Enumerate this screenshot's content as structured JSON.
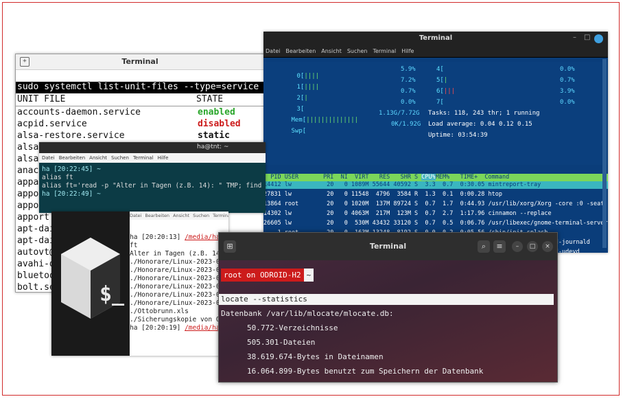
{
  "winA": {
    "title": "Terminal",
    "command": "sudo systemctl list-unit-files --type=service",
    "col_unit": "UNIT FILE",
    "col_state": "STATE",
    "rows": [
      {
        "unit": "accounts-daemon.service",
        "state": "enabled",
        "cls": "enabled"
      },
      {
        "unit": "acpid.service",
        "state": "disabled",
        "cls": "disabled"
      },
      {
        "unit": "alsa-restore.service",
        "state": "static",
        "cls": "static"
      },
      {
        "unit": "alsa-sta",
        "state": "",
        "cls": "static"
      },
      {
        "unit": "alsa-uti",
        "state": "",
        "cls": "static"
      },
      {
        "unit": "anacron.",
        "state": "",
        "cls": "static"
      },
      {
        "unit": "apparmor",
        "state": "",
        "cls": "static"
      },
      {
        "unit": "apport-a",
        "state": "",
        "cls": "static"
      },
      {
        "unit": "apport-f",
        "state": "",
        "cls": "static"
      },
      {
        "unit": "apport.s",
        "state": "",
        "cls": "static"
      },
      {
        "unit": "apt-dail",
        "state": "",
        "cls": "static"
      },
      {
        "unit": "apt-dail",
        "state": "",
        "cls": "static"
      },
      {
        "unit": "autovt@.",
        "state": "",
        "cls": "static"
      },
      {
        "unit": "avahi-da",
        "state": "",
        "cls": "static"
      },
      {
        "unit": "bluetoot",
        "state": "",
        "cls": "static"
      },
      {
        "unit": "bolt.ser",
        "state": "",
        "cls": "static"
      }
    ]
  },
  "winB": {
    "title": "Terminal",
    "menu": [
      "Datei",
      "Bearbeiten",
      "Ansicht",
      "Suchen",
      "Terminal",
      "Hilfe"
    ],
    "cpus_left": [
      {
        "label": "0",
        "bar": "||||",
        "pct": "5.9%"
      },
      {
        "label": "1",
        "bar": "||||",
        "pct": "7.2%"
      },
      {
        "label": "2",
        "bar": "|",
        "pct": "0.7%"
      },
      {
        "label": "3",
        "bar": "",
        "pct": "0.0%"
      }
    ],
    "cpus_right": [
      {
        "label": "4",
        "bar": "",
        "pct": "0.0%"
      },
      {
        "label": "5",
        "bar": "|",
        "pct": "0.7%"
      },
      {
        "label": "6",
        "bar": "|||",
        "pct": "3.9%"
      },
      {
        "label": "7",
        "bar": "",
        "pct": "0.0%"
      }
    ],
    "mem_label": "Mem",
    "mem_bar": "||||||||||||||",
    "mem_val": "1.13G/7.72G",
    "swp_label": "Swp",
    "swp_val": "0K/1.92G",
    "tasks": "Tasks: 118, 243 thr; 1 running",
    "load": "Load average: 0.04 0.12 0.15",
    "uptime": "Uptime: 03:54:39",
    "proc_header_a": "  PID USER       PRI  NI  VIRT   RES   SHR S ",
    "proc_header_sort": "CPU%",
    "proc_header_b": "MEM%   TIME+  Command",
    "selected_row": "14412 lw          20   0 1089M 55644 40592 S  3.3  0.7  0:30.05 mintreport-tray",
    "processes": [
      "27831 lw          20   0 11548  4796  3584 R  1.3  0.1  0:00.28 htop",
      "13864 root        20   0 1020M  137M 89724 S  0.7  1.7  0:44.93 /usr/lib/xorg/Xorg -core :0 -seat",
      "14302 lw          20   0 4063M  217M  123M S  0.7  2.7  1:17.96 cinnamon --replace",
      "26605 lw          20   0  530M 43432 33120 S  0.7  0.5  0:06.76 /usr/libexec/gnome-terminal-server",
      "    1 root        20   0  163M 13248  8192 S  0.0  0.2  0:05.56 /sbin/init splash",
      "  454 root        19  -1 76932 39240 37900 S  0.0  0.5  0:00.63 /lib/systemd/systemd-journald",
      "  495 root        20   0 27400  7740  4644 S  0.0  0.1  0:00.75 /lib/systemd/systemd-udevd",
      " 1067 systemd-r   20   0 25392 13476  9352 S  0.0  0.2  0:00.36 /lib/systemd/systemd-resolved",
      "                                                                  imesyncd"
    ]
  },
  "winC": {
    "title": "ha@tnt: ~",
    "menu": [
      "Datei",
      "Bearbeiten",
      "Ansicht",
      "Suchen",
      "Terminal",
      "Hilfe"
    ],
    "lines": [
      {
        "text": "ha [20:22:45] ~",
        "cls": "prompt"
      },
      {
        "text": "alias ft",
        "cls": ""
      },
      {
        "text": "alias ft='read -p \"Alter in Tagen (z.B. 14): \" TMP; find",
        "cls": ""
      },
      {
        "text": "ha [20:22:49] ~",
        "cls": "prompt"
      }
    ]
  },
  "winD": {
    "menu": [
      "Datei",
      "Bearbeiten",
      "Ansicht",
      "Suchen",
      "Terminal",
      "Hilfe"
    ],
    "logo_text": "$_",
    "prompt1_a": "ha [20:20:13] ",
    "prompt1_path": "/media/ha",
    "lines": [
      "ft",
      "Alter in Tagen (z.B. 14",
      "./Honorare/Linux-2023-0",
      "./Honorare/Linux-2023-0",
      "./Honorare/Linux-2023-0",
      "./Honorare/Linux-2023-0",
      "./Honorare/Linux-2023-0",
      "./Honorare/Linux-2023-0",
      "./Ottobrunn.xls",
      "./Sicherungskopie von O"
    ],
    "prompt2_a": "ha [20:20:19] ",
    "prompt2_path": "/media/ha"
  },
  "winE": {
    "title": "Terminal",
    "host": "root on ODROID-H2",
    "tilde": "~",
    "command": "locate --statistics",
    "db_line": "Datenbank /var/lib/mlocate/mlocate.db:",
    "stats": [
      "50.772-Verzeichnisse",
      "505.301-Dateien",
      "38.619.674-Bytes in Dateinamen",
      "16.064.899-Bytes benutzt zum Speichern der Datenbank"
    ]
  }
}
